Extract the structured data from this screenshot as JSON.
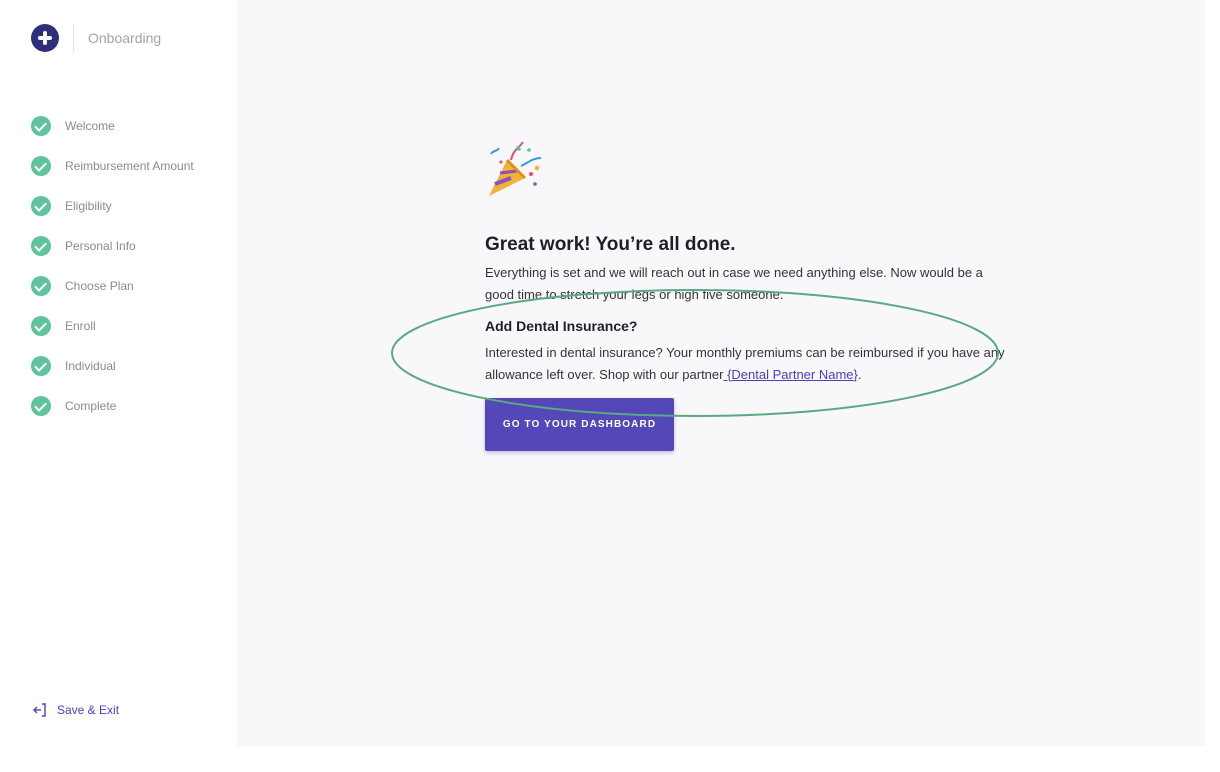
{
  "brand": {
    "title": "Onboarding",
    "logo_icon": "plus-circle-icon",
    "logo_color": "#2e2f7a"
  },
  "sidebar": {
    "steps": [
      {
        "label": "Welcome",
        "status": "complete"
      },
      {
        "label": "Reimbursement Amount",
        "status": "complete"
      },
      {
        "label": "Eligibility",
        "status": "complete"
      },
      {
        "label": "Personal Info",
        "status": "complete"
      },
      {
        "label": "Choose Plan",
        "status": "complete"
      },
      {
        "label": "Enroll",
        "status": "complete"
      },
      {
        "label": "Individual",
        "status": "complete"
      },
      {
        "label": "Complete",
        "status": "complete"
      }
    ],
    "step_icon": "check-circle-icon",
    "check_color": "#5fc49d",
    "save_exit": {
      "label": "Save & Exit",
      "icon": "exit-arrow-icon"
    }
  },
  "main": {
    "emoji_icon": "party-popper-icon",
    "headline": "Great work! You’re all done.",
    "body": "Everything is set and we will reach out in case we need anything else. Now would be a good time to stretch your legs or high five someone.",
    "dental": {
      "title": "Add Dental Insurance?",
      "text": "Interested in dental insurance? Your monthly premiums can be reimbursed if you have any allowance left over. Shop with our partner",
      "link": " {Dental Partner Name}",
      "suffix": "."
    },
    "cta_label": "GO TO YOUR DASHBOARD",
    "accent_color": "#5447b8",
    "annotation_color": "#5aa983"
  }
}
